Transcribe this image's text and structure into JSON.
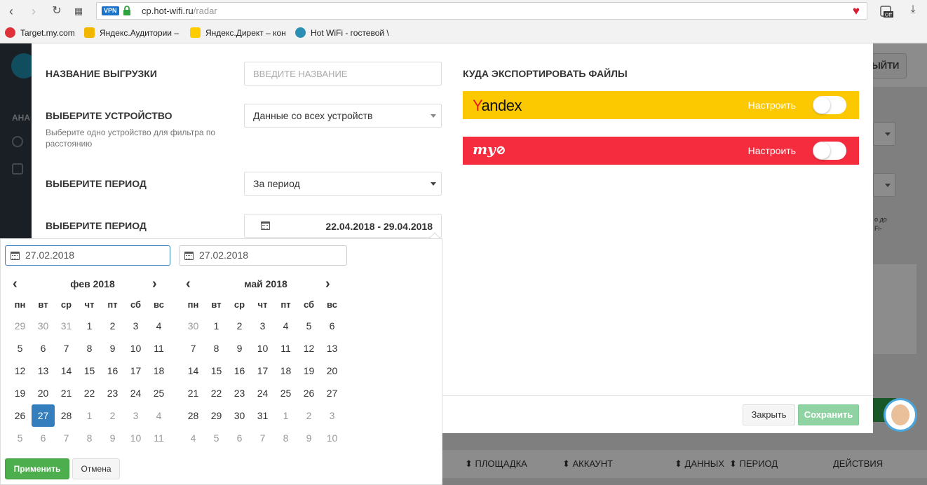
{
  "browser": {
    "vpn_label": "VPN",
    "url_host": "cp.hot-wifi.ru",
    "url_path": "/radar",
    "off_label": "Off",
    "bookmarks": [
      {
        "label": "Target.my.com",
        "color": "#e0313b"
      },
      {
        "label": "Яндекс.Аудитории –",
        "color": "#f2b600"
      },
      {
        "label": "Яндекс.Директ – кон",
        "color": "#ffcc00"
      },
      {
        "label": "Hot WiFi - гостевой \\",
        "color": "#2b8fb3"
      }
    ]
  },
  "background": {
    "sidebar_label": "АНА",
    "exit_label": "ЫЙТИ",
    "small_text_1": "о до",
    "small_text_2": "Fi-",
    "table_headers": [
      "ПЛОЩАДКА",
      "АККАУНТ",
      "ДАННЫХ",
      "ПЕРИОД",
      "ДЕЙСТВИЯ"
    ]
  },
  "modal": {
    "name_label": "НАЗВАНИЕ ВЫГРУЗКИ",
    "name_placeholder": "ВВЕДИТЕ НАЗВАНИЕ",
    "device_label": "ВЫБЕРИТЕ УСТРОЙСТВО",
    "device_hint": "Выберите одно устройство для фильтра по расстоянию",
    "device_value": "Данные со всех устройств",
    "period_label": "ВЫБЕРИТЕ ПЕРИОД",
    "period_value": "За период",
    "period_range_label": "ВЫБЕРИТЕ ПЕРИОД",
    "period_range_value": "22.04.2018 - 29.04.2018",
    "export_title": "КУДА ЭКСПОРТИРОВАТЬ ФАЙЛЫ",
    "services": [
      {
        "name": "Yandex",
        "configure_label": "Настроить",
        "enabled": false,
        "color": "#fcc900"
      },
      {
        "name": "my",
        "configure_label": "Настроить",
        "enabled": false,
        "color": "#f42c3d"
      }
    ],
    "close_label": "Закрыть",
    "save_label": "Сохранить"
  },
  "datepicker": {
    "start_input": "27.02.2018",
    "end_input": "27.02.2018",
    "weekdays": [
      "пн",
      "вт",
      "ср",
      "чт",
      "пт",
      "сб",
      "вс"
    ],
    "left": {
      "title": "фев 2018",
      "weeks": [
        [
          "29",
          "30",
          "31",
          "1",
          "2",
          "3",
          "4"
        ],
        [
          "5",
          "6",
          "7",
          "8",
          "9",
          "10",
          "11"
        ],
        [
          "12",
          "13",
          "14",
          "15",
          "16",
          "17",
          "18"
        ],
        [
          "19",
          "20",
          "21",
          "22",
          "23",
          "24",
          "25"
        ],
        [
          "26",
          "27",
          "28",
          "1",
          "2",
          "3",
          "4"
        ],
        [
          "5",
          "6",
          "7",
          "8",
          "9",
          "10",
          "11"
        ]
      ],
      "off": [
        [
          0,
          0
        ],
        [
          0,
          1
        ],
        [
          0,
          2
        ],
        [
          4,
          3
        ],
        [
          4,
          4
        ],
        [
          4,
          5
        ],
        [
          4,
          6
        ],
        [
          5,
          0
        ],
        [
          5,
          1
        ],
        [
          5,
          2
        ],
        [
          5,
          3
        ],
        [
          5,
          4
        ],
        [
          5,
          5
        ],
        [
          5,
          6
        ]
      ],
      "selected": [
        4,
        1
      ]
    },
    "right": {
      "title": "май 2018",
      "weeks": [
        [
          "30",
          "1",
          "2",
          "3",
          "4",
          "5",
          "6"
        ],
        [
          "7",
          "8",
          "9",
          "10",
          "11",
          "12",
          "13"
        ],
        [
          "14",
          "15",
          "16",
          "17",
          "18",
          "19",
          "20"
        ],
        [
          "21",
          "22",
          "23",
          "24",
          "25",
          "26",
          "27"
        ],
        [
          "28",
          "29",
          "30",
          "31",
          "1",
          "2",
          "3"
        ],
        [
          "4",
          "5",
          "6",
          "7",
          "8",
          "9",
          "10"
        ]
      ],
      "off": [
        [
          0,
          0
        ],
        [
          4,
          4
        ],
        [
          4,
          5
        ],
        [
          4,
          6
        ],
        [
          5,
          0
        ],
        [
          5,
          1
        ],
        [
          5,
          2
        ],
        [
          5,
          3
        ],
        [
          5,
          4
        ],
        [
          5,
          5
        ],
        [
          5,
          6
        ]
      ],
      "selected": null
    },
    "apply_label": "Применить",
    "cancel_label": "Отмена"
  }
}
